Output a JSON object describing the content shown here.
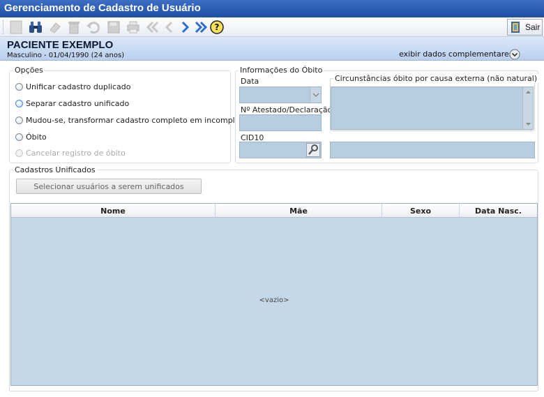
{
  "window": {
    "title": "Gerenciamento de Cadastro de Usuário"
  },
  "toolbar": {
    "exit_label": "Sair",
    "icons": [
      "new-icon",
      "binoculars-icon",
      "eraser-icon",
      "trash-icon",
      "undo-icon",
      "save-icon",
      "print-icon",
      "first-icon",
      "previous-icon",
      "next-icon",
      "last-icon",
      "help-icon",
      "exit-door-icon"
    ]
  },
  "patient": {
    "name": "PACIENTE EXEMPLO",
    "info": "Masculino - 01/04/1990 (24 anos)",
    "more_label": "exibir dados complementares..."
  },
  "options": {
    "legend": "Opções",
    "items": [
      {
        "label": "Unificar cadastro duplicado",
        "selected": false,
        "enabled": true
      },
      {
        "label": "Separar cadastro unificado",
        "selected": true,
        "enabled": true
      },
      {
        "label": "Mudou-se, transformar cadastro completo em incompleto",
        "selected": false,
        "enabled": true
      },
      {
        "label": "Óbito",
        "selected": false,
        "enabled": true
      },
      {
        "label": "Cancelar registro de óbito",
        "selected": false,
        "enabled": false
      }
    ]
  },
  "death_info": {
    "legend": "Informações do Óbito",
    "date_label": "Data",
    "certificate_label": "Nº Atestado/Declaração",
    "cid_label": "CID10",
    "circumstances_label": "Circunstâncias óbito por causa externa (não natural)",
    "date_value": "",
    "certificate_value": "",
    "cid_value": "",
    "cid_description": "",
    "circumstances_value": ""
  },
  "unified": {
    "legend": "Cadastros Unificados",
    "select_button": "Selecionar usuários a serem unificados",
    "columns": [
      "Nome",
      "Mãe",
      "Sexo",
      "Data Nasc."
    ],
    "rows": [],
    "empty_text": "<vazio>"
  },
  "colors": {
    "title_bar": "#2b5cb5",
    "field_bg": "#b9cde0",
    "grid_bg": "#c6d8e8"
  }
}
